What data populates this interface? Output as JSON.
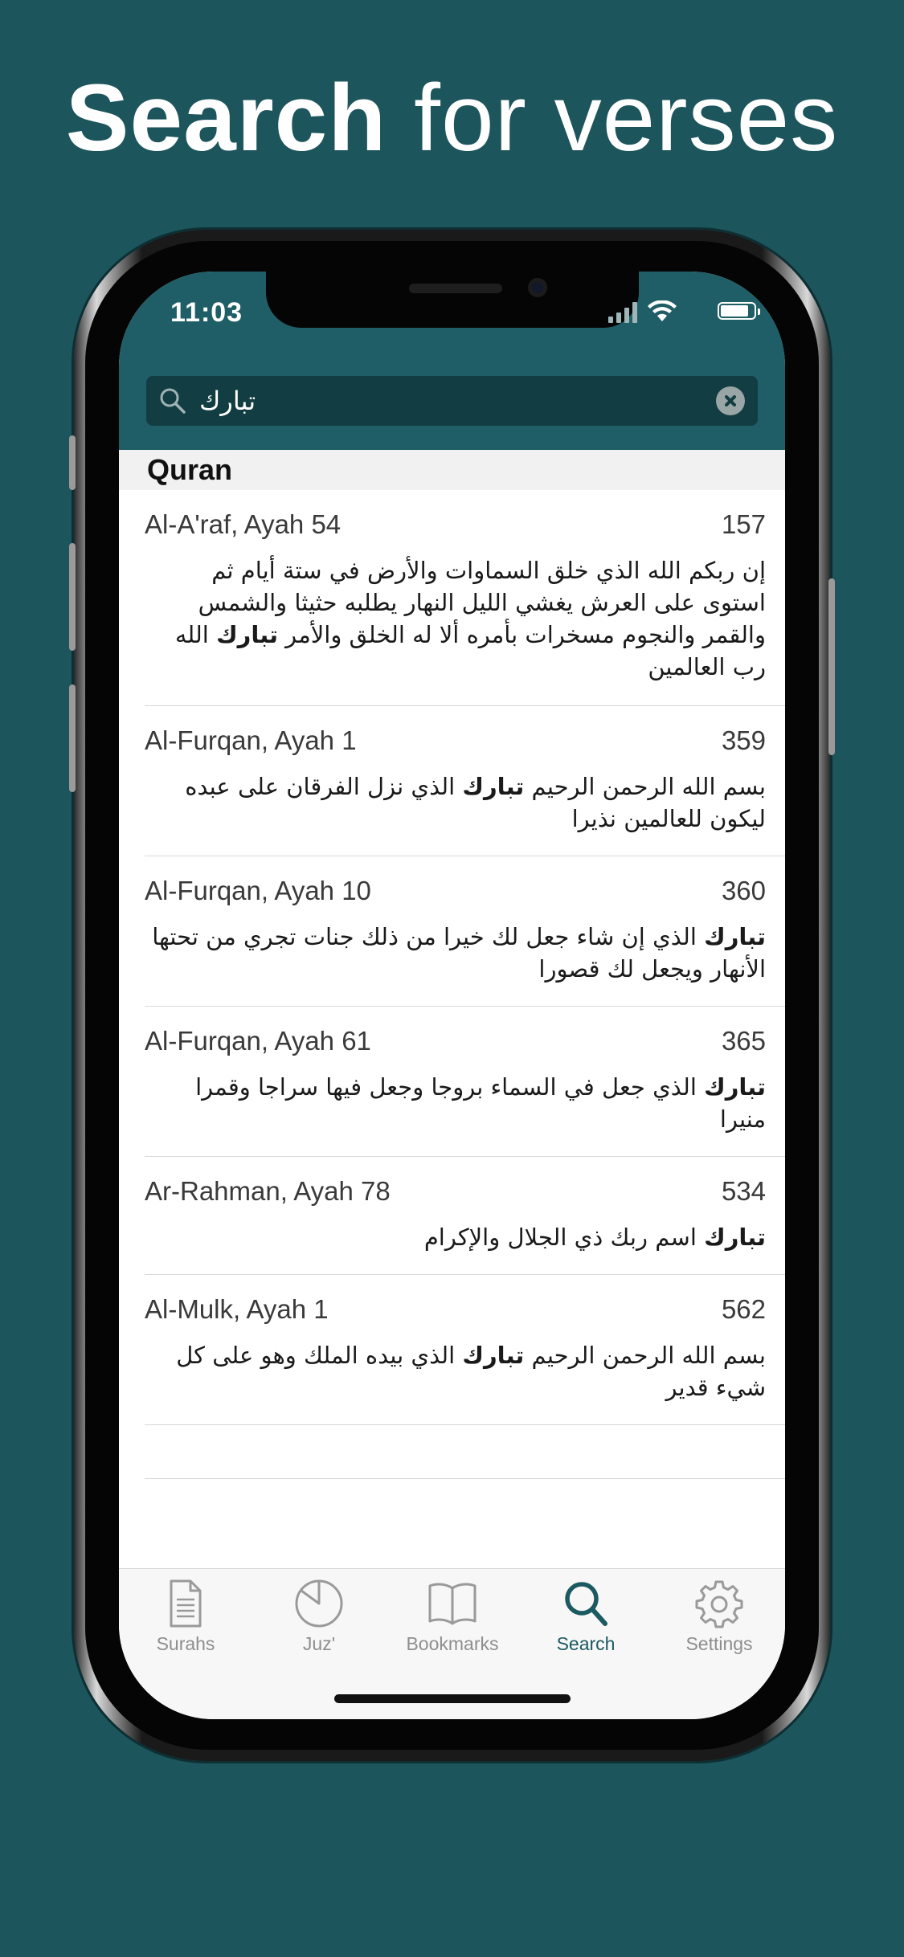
{
  "headline": {
    "bold": "Search",
    "light": "for verses"
  },
  "status_bar": {
    "time": "11:03"
  },
  "search": {
    "query": "تبارك",
    "icon": "magnifier-icon",
    "clear_icon": "clear-x-icon"
  },
  "section": {
    "title": "Quran"
  },
  "results": [
    {
      "reference": "Al-A'raf, Ayah 54",
      "page": "157",
      "verse_before": "إن ربكم الله الذي خلق السماوات والأرض في ستة أيام ثم استوى على العرش يغشي الليل النهار يطلبه حثيثا والشمس والقمر والنجوم مسخرات بأمره ألا له الخلق والأمر ",
      "highlight": "تبارك",
      "verse_after": " الله رب العالمين"
    },
    {
      "reference": "Al-Furqan, Ayah 1",
      "page": "359",
      "verse_before": "بسم الله الرحمن الرحيم ",
      "highlight": "تبارك",
      "verse_after": " الذي نزل الفرقان على عبده ليكون للعالمين نذيرا"
    },
    {
      "reference": "Al-Furqan, Ayah 10",
      "page": "360",
      "verse_before": "",
      "highlight": "تبارك",
      "verse_after": " الذي إن شاء جعل لك خيرا من ذلك جنات تجري من تحتها الأنهار ويجعل لك قصورا"
    },
    {
      "reference": "Al-Furqan, Ayah 61",
      "page": "365",
      "verse_before": "",
      "highlight": "تبارك",
      "verse_after": " الذي جعل في السماء بروجا وجعل فيها سراجا وقمرا منيرا"
    },
    {
      "reference": "Ar-Rahman, Ayah 78",
      "page": "534",
      "verse_before": "",
      "highlight": "تبارك",
      "verse_after": " اسم ربك ذي الجلال والإكرام"
    },
    {
      "reference": "Al-Mulk, Ayah 1",
      "page": "562",
      "verse_before": "بسم الله الرحمن الرحيم ",
      "highlight": "تبارك",
      "verse_after": " الذي بيده الملك وهو على كل شيء قدير"
    }
  ],
  "tabs": [
    {
      "label": "Surahs",
      "icon": "document-icon",
      "active": false
    },
    {
      "label": "Juz'",
      "icon": "pie-icon",
      "active": false
    },
    {
      "label": "Bookmarks",
      "icon": "book-icon",
      "active": false
    },
    {
      "label": "Search",
      "icon": "search-icon",
      "active": true
    },
    {
      "label": "Settings",
      "icon": "gear-icon",
      "active": false
    }
  ],
  "colors": {
    "background": "#1c555c",
    "app_bar": "#1f5e66",
    "search_field": "#123d42",
    "active_tab": "#1c5a62",
    "inactive_tab": "#8e8e8e"
  }
}
